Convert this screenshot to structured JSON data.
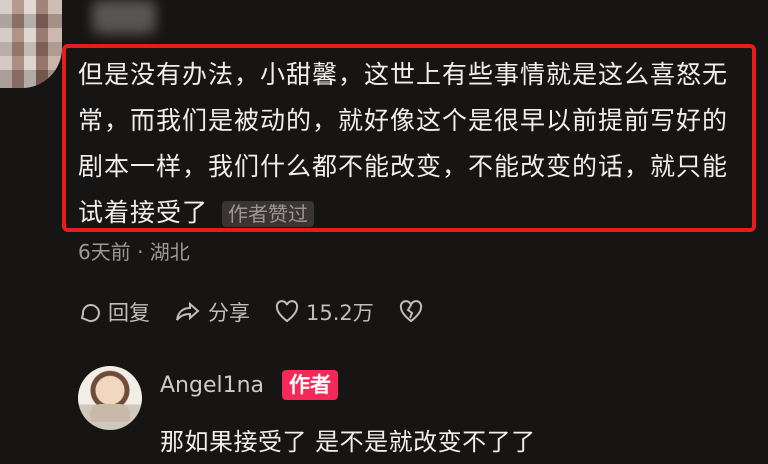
{
  "comment": {
    "text": "但是没有办法，小甜馨，这世上有些事情就是这么喜怒无常，而我们是被动的，就好像这个是很早以前提前写好的剧本一样，我们什么都不能改变，不能改变的话，就只能试着接受了",
    "badge": "作者赞过",
    "meta": "6天前 · 湖北"
  },
  "actions": {
    "reply": "回复",
    "share": "分享",
    "likes": "15.2万"
  },
  "reply": {
    "name": "Angel1na",
    "badge": "作者",
    "text": "那如果接受了 是不是就改变不了了"
  },
  "colors": {
    "background": "#171414",
    "highlight_border": "#e51d1d",
    "author_badge": "#f4295a"
  },
  "icons": [
    "reply-icon",
    "share-icon",
    "heart-icon",
    "broken-heart-icon"
  ]
}
